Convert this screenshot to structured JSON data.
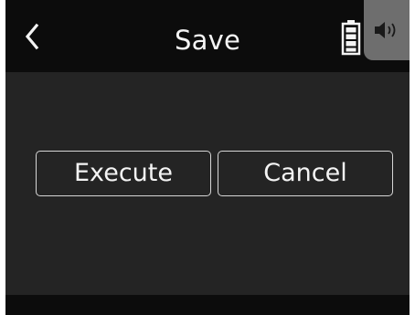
{
  "header": {
    "title": "Save",
    "back_icon": "chevron-left-icon",
    "battery_icon": "battery-icon",
    "speaker_icon": "speaker-icon"
  },
  "dialog": {
    "execute_label": "Execute",
    "cancel_label": "Cancel"
  },
  "colors": {
    "background": "#242424",
    "header": "#0c0c0c",
    "text": "#f4f4f4",
    "button_border": "#d6d6d6",
    "speaker_tab": "#6e6e6e"
  }
}
